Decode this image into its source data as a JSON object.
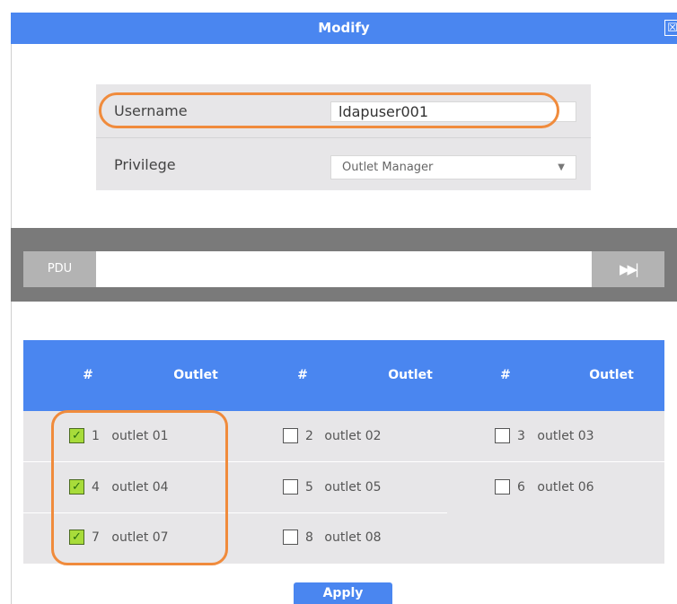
{
  "dialog": {
    "title": "Modify",
    "close_glyph": "☒"
  },
  "form": {
    "username_label": "Username",
    "username_value": "ldapuser001",
    "privilege_label": "Privilege",
    "privilege_value": "Outlet Manager",
    "privilege_arrow": "▼"
  },
  "pdu": {
    "label": "PDU",
    "value": "",
    "next_glyph": "▶▶|"
  },
  "table": {
    "headers": [
      "#",
      "Outlet",
      "#",
      "Outlet",
      "#",
      "Outlet"
    ],
    "outlets": [
      {
        "num": "1",
        "name": "outlet 01",
        "checked": true
      },
      {
        "num": "2",
        "name": "outlet 02",
        "checked": false
      },
      {
        "num": "3",
        "name": "outlet 03",
        "checked": false
      },
      {
        "num": "4",
        "name": "outlet 04",
        "checked": true
      },
      {
        "num": "5",
        "name": "outlet 05",
        "checked": false
      },
      {
        "num": "6",
        "name": "outlet 06",
        "checked": false
      },
      {
        "num": "7",
        "name": "outlet 07",
        "checked": true
      },
      {
        "num": "8",
        "name": "outlet 08",
        "checked": false
      }
    ],
    "check_glyph": "✓"
  },
  "apply_label": "Apply",
  "colors": {
    "accent": "#4a86f0",
    "highlight": "#f08b3c",
    "check": "#a8dc3a"
  }
}
